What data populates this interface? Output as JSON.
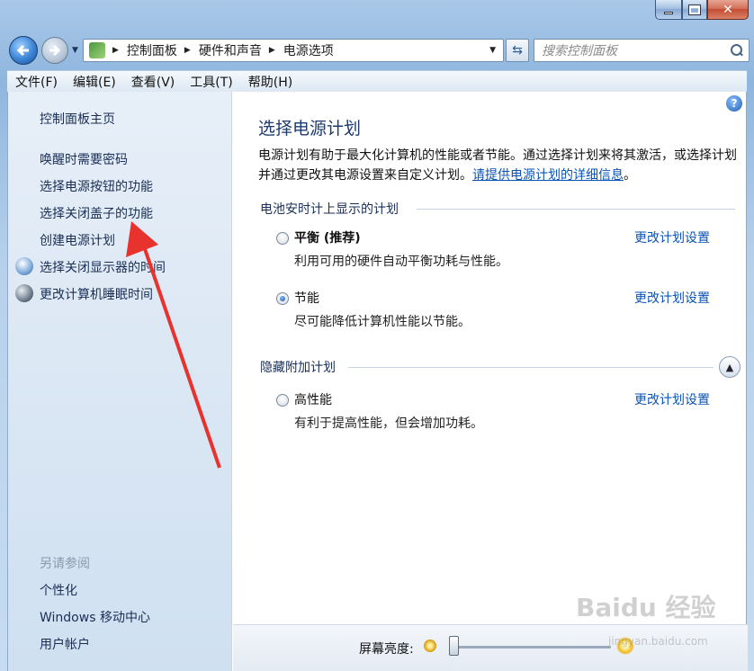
{
  "window": {
    "controls": {
      "minimize": "minimize",
      "maximize": "maximize",
      "close": "close"
    }
  },
  "nav": {
    "breadcrumb": [
      "控制面板",
      "硬件和声音",
      "电源选项"
    ],
    "search_placeholder": "搜索控制面板"
  },
  "menu": [
    "文件(F)",
    "编辑(E)",
    "查看(V)",
    "工具(T)",
    "帮助(H)"
  ],
  "sidebar": {
    "home": "控制面板主页",
    "links": [
      "唤醒时需要密码",
      "选择电源按钮的功能",
      "选择关闭盖子的功能",
      "创建电源计划",
      "选择关闭显示器的时间",
      "更改计算机睡眠时间"
    ],
    "see_also_title": "另请参阅",
    "see_also": [
      "个性化",
      "Windows 移动中心",
      "用户帐户"
    ]
  },
  "main": {
    "title": "选择电源计划",
    "desc_text": "电源计划有助于最大化计算机的性能或者节能。通过选择计划来将其激活，或选择计划并通过更改其电源设置来自定义计划。",
    "desc_link": "请提供电源计划的详细信息",
    "desc_end": "。",
    "group1_title": "电池安时计上显示的计划",
    "group2_title": "隐藏附加计划",
    "plans": [
      {
        "name": "平衡 (推荐)",
        "desc": "利用可用的硬件自动平衡功耗与性能。",
        "link": "更改计划设置",
        "selected": false
      },
      {
        "name": "节能",
        "desc": "尽可能降低计算机性能以节能。",
        "link": "更改计划设置",
        "selected": true
      },
      {
        "name": "高性能",
        "desc": "有利于提高性能，但会增加功耗。",
        "link": "更改计划设置",
        "selected": false
      }
    ],
    "brightness_label": "屏幕亮度:",
    "brightness_level": 0.0
  },
  "watermark": {
    "logo": "Baidu 经验",
    "url": "jingyan.baidu.com"
  },
  "colors": {
    "link": "#0a52b4",
    "title": "#1e3a6e",
    "arrow": "#e8322e"
  }
}
